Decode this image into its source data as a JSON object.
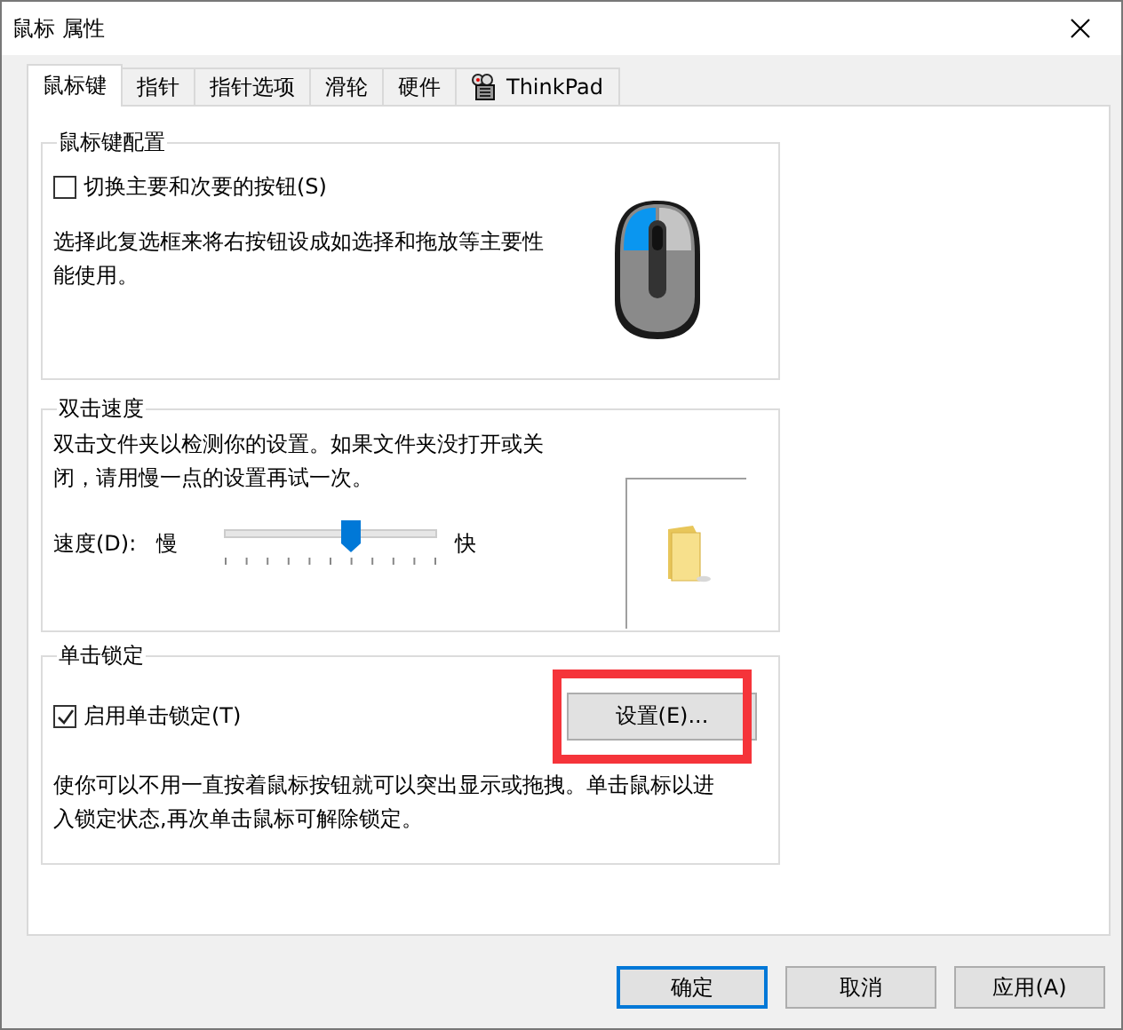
{
  "window": {
    "title": "鼠标 属性"
  },
  "tabs": [
    {
      "label": "鼠标键",
      "selected": true,
      "kind": "plain"
    },
    {
      "label": "指针",
      "selected": false,
      "kind": "plain"
    },
    {
      "label": "指针选项",
      "selected": false,
      "kind": "plain"
    },
    {
      "label": "滑轮",
      "selected": false,
      "kind": "plain"
    },
    {
      "label": "硬件",
      "selected": false,
      "kind": "plain"
    },
    {
      "label": "ThinkPad",
      "selected": false,
      "kind": "icon"
    }
  ],
  "button_config": {
    "title": "鼠标键配置",
    "checkbox": {
      "label": "切换主要和次要的按钮(S)",
      "checked": false
    },
    "description": "选择此复选框来将右按钮设成如选择和拖放等主要性能使用。"
  },
  "double_click": {
    "title": "双击速度",
    "description": "双击文件夹以检测你的设置。如果文件夹没打开或关闭，请用慢一点的设置再试一次。",
    "speed_label": "速度(D):",
    "slow_label": "慢",
    "fast_label": "快",
    "slider": {
      "level": 0.6
    }
  },
  "click_lock": {
    "title": "单击锁定",
    "checkbox": {
      "label": "启用单击锁定(T)",
      "checked": true
    },
    "settings_button": {
      "label": "设置(E)...",
      "highlighted": true
    },
    "description": "使你可以不用一直按着鼠标按钮就可以突出显示或拖拽。单击鼠标以进入锁定状态,再次单击鼠标可解除锁定。"
  },
  "buttons": [
    {
      "label": "确定",
      "default": true
    },
    {
      "label": "取消",
      "default": false
    },
    {
      "label": "应用(A)",
      "default": false
    }
  ]
}
